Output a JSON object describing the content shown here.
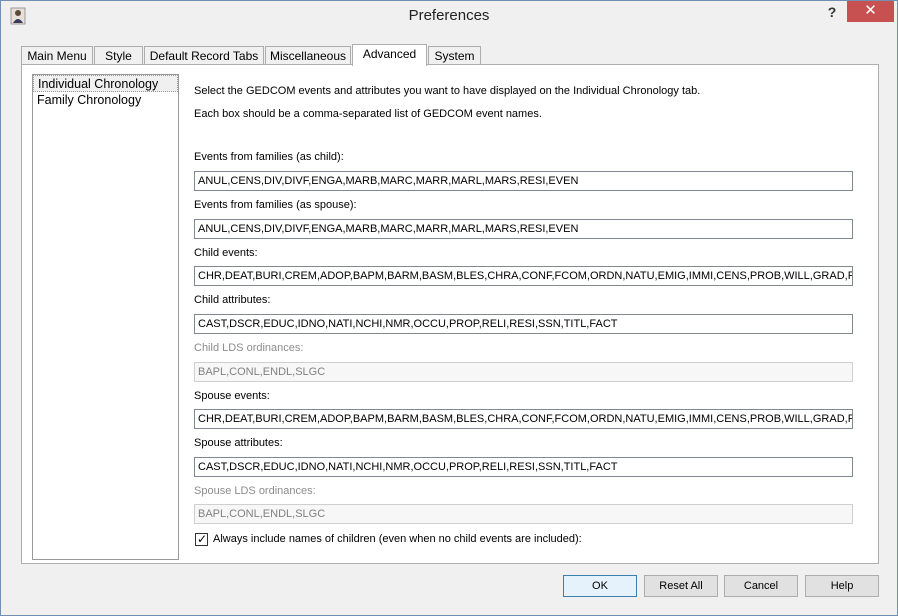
{
  "window": {
    "title": "Preferences",
    "help_glyph": "?",
    "close_glyph": "✕",
    "app_icon": "person-icon"
  },
  "tabs": [
    {
      "label": "Main Menu"
    },
    {
      "label": "Style"
    },
    {
      "label": "Default Record Tabs"
    },
    {
      "label": "Miscellaneous"
    },
    {
      "label": "Advanced",
      "active": true
    },
    {
      "label": "System"
    }
  ],
  "nav": {
    "items": [
      {
        "label": "Individual Chronology",
        "selected": true
      },
      {
        "label": "Family Chronology"
      }
    ]
  },
  "intro": {
    "line1": "Select the GEDCOM events and attributes you want to have displayed on the Individual Chronology tab.",
    "line2": "Each box should be a comma-separated list of GEDCOM event names."
  },
  "fields": [
    {
      "label": "Events from families (as child):",
      "value": "ANUL,CENS,DIV,DIVF,ENGA,MARB,MARC,MARR,MARL,MARS,RESI,EVEN",
      "enabled": true
    },
    {
      "label": "Events from families (as spouse):",
      "value": "ANUL,CENS,DIV,DIVF,ENGA,MARB,MARC,MARR,MARL,MARS,RESI,EVEN",
      "enabled": true
    },
    {
      "label": "Child events:",
      "value": "CHR,DEAT,BURI,CREM,ADOP,BAPM,BARM,BASM,BLES,CHRA,CONF,FCOM,ORDN,NATU,EMIG,IMMI,CENS,PROB,WILL,GRAD,RETI,EVEN",
      "enabled": true
    },
    {
      "label": "Child attributes:",
      "value": "CAST,DSCR,EDUC,IDNO,NATI,NCHI,NMR,OCCU,PROP,RELI,RESI,SSN,TITL,FACT",
      "enabled": true
    },
    {
      "label": "Child LDS ordinances:",
      "value": "BAPL,CONL,ENDL,SLGC",
      "enabled": false
    },
    {
      "label": "Spouse events:",
      "value": "CHR,DEAT,BURI,CREM,ADOP,BAPM,BARM,BASM,BLES,CHRA,CONF,FCOM,ORDN,NATU,EMIG,IMMI,CENS,PROB,WILL,GRAD,RETI,EVEN",
      "enabled": true
    },
    {
      "label": "Spouse attributes:",
      "value": "CAST,DSCR,EDUC,IDNO,NATI,NCHI,NMR,OCCU,PROP,RELI,RESI,SSN,TITL,FACT",
      "enabled": true
    },
    {
      "label": "Spouse LDS ordinances:",
      "value": "BAPL,CONL,ENDL,SLGC",
      "enabled": false
    }
  ],
  "checkbox": {
    "label": "Always include names of children (even when no child events are included):",
    "checked": true,
    "mark": "✓"
  },
  "buttons": {
    "ok": "OK",
    "reset_all": "Reset All",
    "cancel": "Cancel",
    "help": "Help"
  },
  "colors": {
    "close_button": "#c75050",
    "default_button_border": "#3c7fb1"
  }
}
